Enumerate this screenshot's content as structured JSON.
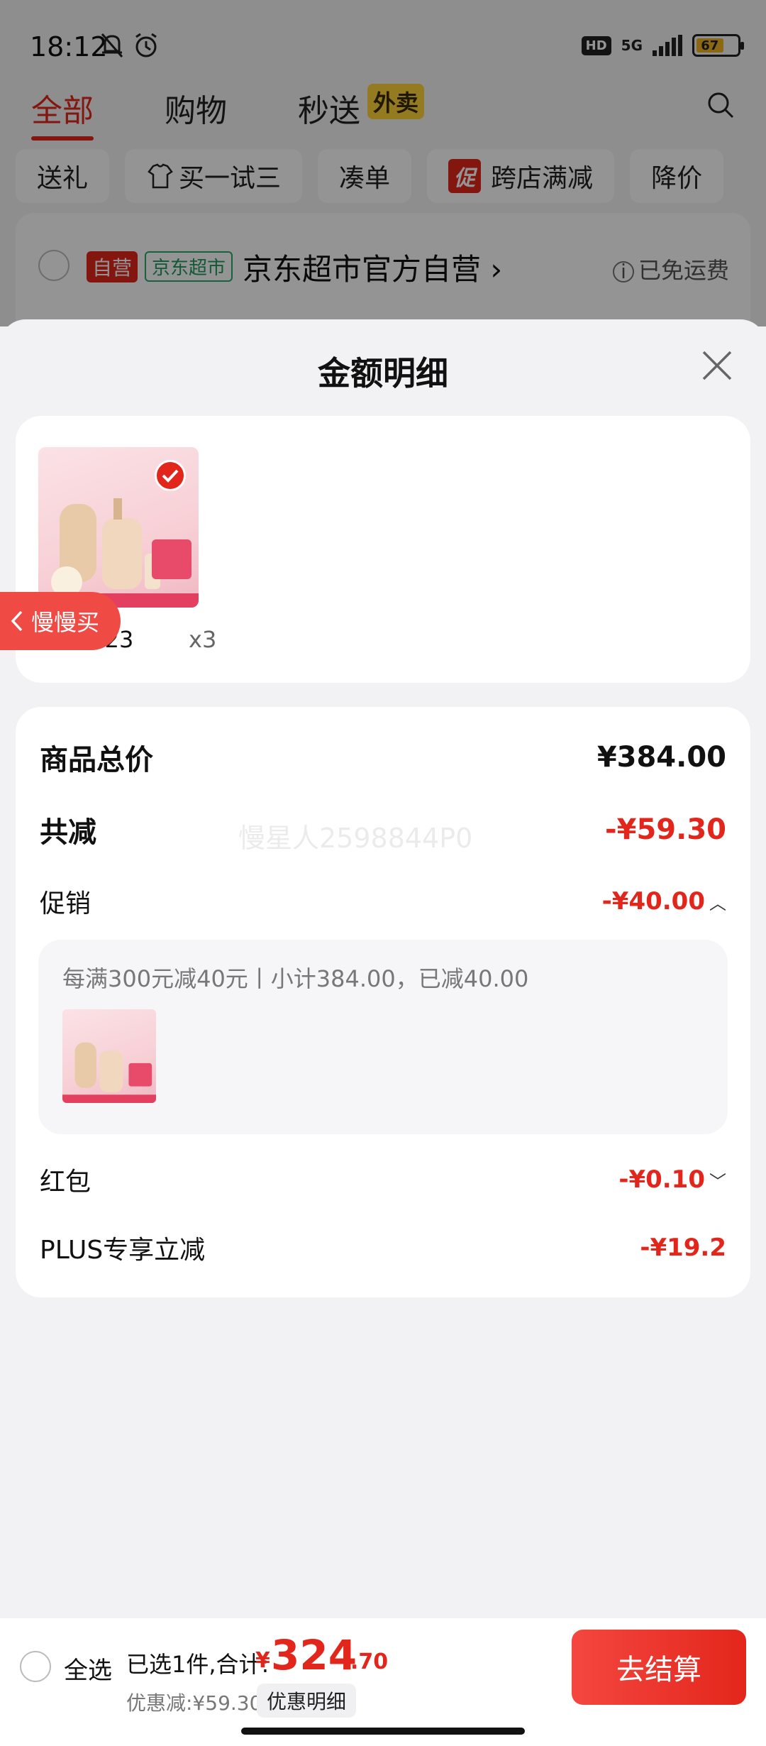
{
  "status_bar": {
    "time": "18:12",
    "network": "5G",
    "battery": "67",
    "hd": "HD"
  },
  "top_tabs": {
    "items": [
      "全部",
      "购物",
      "秒送"
    ],
    "waimai": "外卖"
  },
  "chips": {
    "items": [
      "送礼",
      "买一试三",
      "凑单",
      "跨店满减",
      "降价"
    ],
    "cu_tag": "促"
  },
  "store": {
    "ziying": "自营",
    "super": "京东超市",
    "name": "京东超市官方自营 ›",
    "ship": "已免运费"
  },
  "sheet": {
    "title": "金额明细"
  },
  "product": {
    "price": "¥108.23",
    "qty": "x3"
  },
  "slow_buy": "慢慢买",
  "details": {
    "total_label": "商品总价",
    "total_value": "¥384.00",
    "reduce_label": "共减",
    "reduce_value": "-¥59.30",
    "promo_label": "促销",
    "promo_value": "-¥40.00",
    "promo_desc": "每满300元减40元丨小计384.00，已减40.00",
    "redpack_label": "红包",
    "redpack_value": "-¥0.10",
    "plus_label": "PLUS专享立减",
    "plus_value": "-¥19.2"
  },
  "watermark": "慢星人2598844P0",
  "checkout": {
    "select_all": "全选",
    "selected": "已选1件,合计:",
    "currency": "¥",
    "total_int": "324",
    "total_dec": ".70",
    "discount": "优惠减:¥59.30",
    "detail_btn": "优惠明细",
    "submit": "去结算"
  },
  "colors": {
    "accent": "#e3261c",
    "green": "#2aa86a",
    "yellow": "#ffd43a"
  }
}
